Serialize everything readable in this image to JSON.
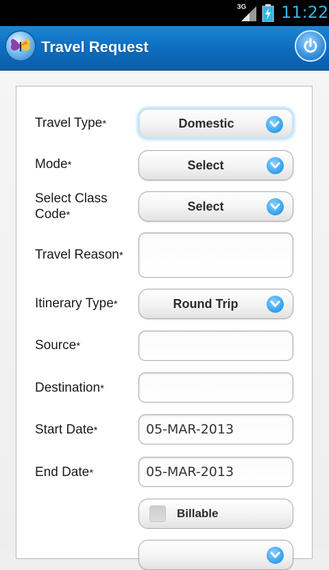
{
  "status_bar": {
    "network": "3G",
    "time": "11:22",
    "time_color": "#33b5e5"
  },
  "header": {
    "title": "Travel Request",
    "logo_icon": "butterfly-icon",
    "power_icon": "power-icon",
    "accent": "#0f6fc2"
  },
  "form": {
    "travel_type": {
      "label": "Travel Type",
      "required": "*",
      "value": "Domestic"
    },
    "mode": {
      "label": "Mode",
      "required": "*",
      "value": "Select"
    },
    "class_code": {
      "label_line1": "Select Class",
      "label_line2": "Code",
      "required": "*",
      "value": "Select"
    },
    "travel_reason": {
      "label": "Travel Reason",
      "required": "*",
      "value": ""
    },
    "itinerary_type": {
      "label": "Itinerary Type",
      "required": "*",
      "value": "Round Trip"
    },
    "source": {
      "label": "Source",
      "required": "*",
      "value": ""
    },
    "destination": {
      "label": "Destination",
      "required": "*",
      "value": ""
    },
    "start_date": {
      "label": "Start Date",
      "required": "*",
      "value": "05-MAR-2013"
    },
    "end_date": {
      "label": "End Date",
      "required": "*",
      "value": "05-MAR-2013"
    },
    "billable": {
      "label": "Billable",
      "checked": false
    }
  }
}
